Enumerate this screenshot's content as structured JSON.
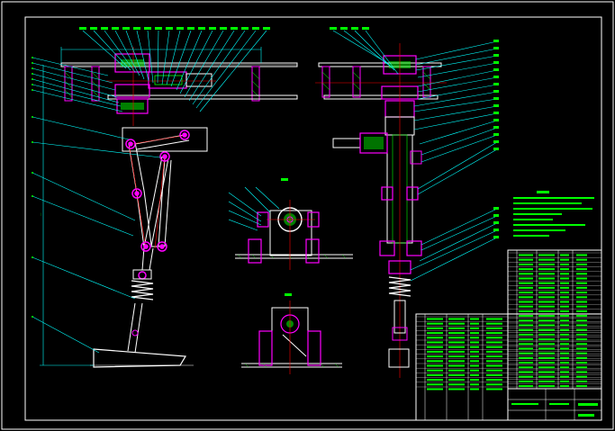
{
  "drawing": {
    "background": "#000000",
    "colors": {
      "frame": "#ffffff",
      "leader": "#00ffff",
      "part": "#ff00ff",
      "hatch": "#00ff00",
      "center": "#ff0000",
      "weld": "#ffff00",
      "text": "#00ff00"
    },
    "views": [
      "side-elevation-view",
      "front-elevation-view",
      "bearing-section-view",
      "hinge-section-view",
      "technical-requirements",
      "parts-list",
      "title-block"
    ],
    "labels_legible": false
  }
}
